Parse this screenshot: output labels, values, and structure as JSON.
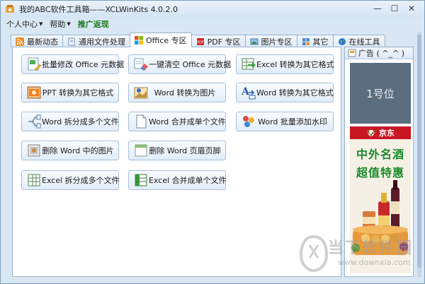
{
  "window": {
    "title": "我的ABC软件工具箱——XCLWinKits   4.0.2.0",
    "min_label": "—",
    "max_label": "☐",
    "close_label": "✕"
  },
  "menu": {
    "items": [
      {
        "label": "个人中心",
        "has_dropdown": true
      },
      {
        "label": "帮助",
        "has_dropdown": true
      },
      {
        "label": "推广返现",
        "has_dropdown": false
      }
    ]
  },
  "tabs": [
    {
      "label": "最新动态",
      "icon": "rss-icon",
      "active": false
    },
    {
      "label": "通用文件处理",
      "icon": "file-icon",
      "active": false
    },
    {
      "label": "Office 专区",
      "icon": "office-icon",
      "active": true
    },
    {
      "label": "PDF 专区",
      "icon": "pdf-icon",
      "active": false
    },
    {
      "label": "图片专区",
      "icon": "image-icon",
      "active": false
    },
    {
      "label": "其它",
      "icon": "folder-icon",
      "active": false
    },
    {
      "label": "在线工具",
      "icon": "globe-icon",
      "active": false
    }
  ],
  "tools": [
    {
      "label": "批量修改 Office 元数据",
      "icon": "edit-metadata-icon"
    },
    {
      "label": "一键清空 Office 元数据",
      "icon": "eraser-icon"
    },
    {
      "label": "Excel 转换为其它格式",
      "icon": "excel-convert-icon"
    },
    {
      "label": "PPT 转换为其它格式",
      "icon": "ppt-icon"
    },
    {
      "label": "Word 转换为图片",
      "icon": "word-to-image-icon"
    },
    {
      "label": "Word 转换为其它格式",
      "icon": "font-convert-icon"
    },
    {
      "label": "Word 拆分成多个文件",
      "icon": "split-icon"
    },
    {
      "label": "Word 合并成单个文件",
      "icon": "document-icon"
    },
    {
      "label": "Word 批量添加水印",
      "icon": "watermark-icon"
    },
    {
      "label": "删除 Word 中的图片",
      "icon": "delete-image-icon"
    },
    {
      "label": "删除 Word 页眉页脚",
      "icon": "header-footer-icon"
    },
    {
      "label": "Excel 拆分成多个文件",
      "icon": "excel-split-icon"
    },
    {
      "label": "Excel 合并成单个文件",
      "icon": "excel-merge-icon"
    }
  ],
  "ad": {
    "header": "广告 ( ^_^ )",
    "slot1": "1号位",
    "jd_brand": "京东",
    "line1": "中外名酒",
    "line2": "超值特惠"
  },
  "watermark": {
    "text": "当下软件园",
    "url": "www.downxia.com"
  },
  "colors": {
    "jd_red": "#c81623",
    "promo_green": "#1a7a1a",
    "ad_text_green": "#1a8a2a",
    "slot_bg": "#5a6e80"
  }
}
